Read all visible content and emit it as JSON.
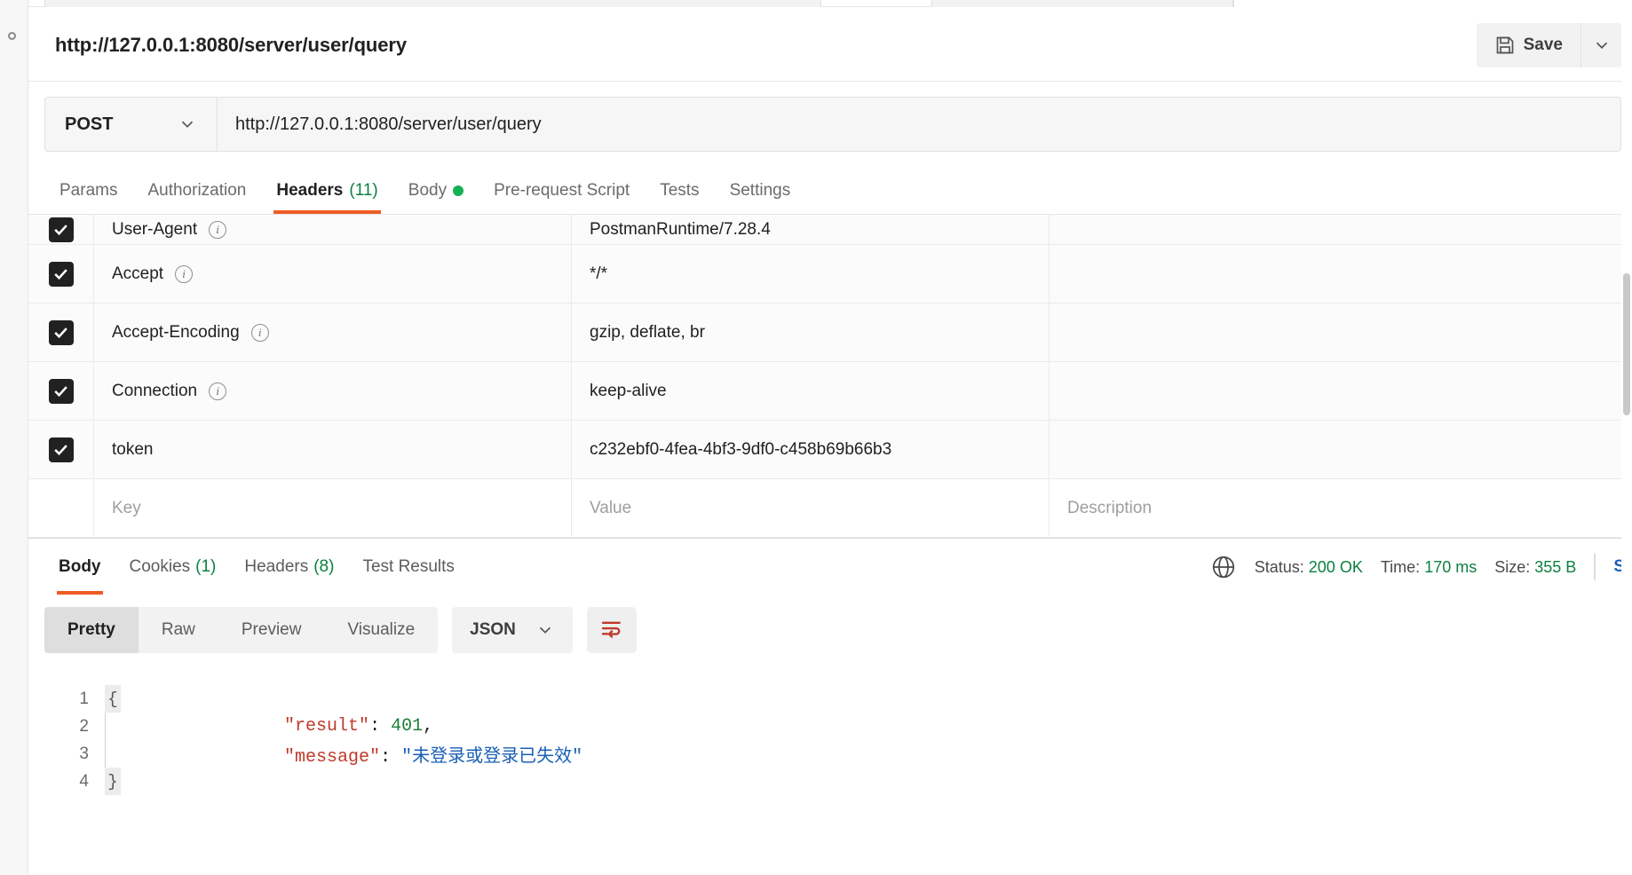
{
  "request": {
    "title": "http://127.0.0.1:8080/server/user/query",
    "method": "POST",
    "url": "http://127.0.0.1:8080/server/user/query",
    "save_label": "Save",
    "tabs": [
      {
        "label": "Params",
        "count": "",
        "active": false
      },
      {
        "label": "Authorization",
        "count": "",
        "active": false
      },
      {
        "label": "Headers",
        "count": "(11)",
        "active": true
      },
      {
        "label": "Body",
        "count": "",
        "active": false,
        "dot": true
      },
      {
        "label": "Pre-request Script",
        "count": "",
        "active": false
      },
      {
        "label": "Tests",
        "count": "",
        "active": false
      },
      {
        "label": "Settings",
        "count": "",
        "active": false
      }
    ]
  },
  "headers_table": {
    "columns": [
      "Key",
      "Value",
      "Description"
    ],
    "placeholders": {
      "key": "Key",
      "value": "Value",
      "description": "Description"
    },
    "rows": [
      {
        "checked": true,
        "key": "User-Agent",
        "info": true,
        "value": "PostmanRuntime/7.28.4",
        "description": ""
      },
      {
        "checked": true,
        "key": "Accept",
        "info": true,
        "value": "*/*",
        "description": ""
      },
      {
        "checked": true,
        "key": "Accept-Encoding",
        "info": true,
        "value": "gzip, deflate, br",
        "description": ""
      },
      {
        "checked": true,
        "key": "Connection",
        "info": true,
        "value": "keep-alive",
        "description": ""
      },
      {
        "checked": true,
        "key": "token",
        "info": false,
        "value": "c232ebf0-4fea-4bf3-9df0-c458b69b66b3",
        "description": ""
      }
    ]
  },
  "response": {
    "tabs": [
      {
        "label": "Body",
        "count": "",
        "active": true
      },
      {
        "label": "Cookies",
        "count": "(1)",
        "active": false
      },
      {
        "label": "Headers",
        "count": "(8)",
        "active": false
      },
      {
        "label": "Test Results",
        "count": "",
        "active": false
      }
    ],
    "status_label": "Status:",
    "status_value": "200 OK",
    "time_label": "Time:",
    "time_value": "170 ms",
    "size_label": "Size:",
    "size_value": "355 B",
    "save_response_label": "S",
    "format_buttons": [
      "Pretty",
      "Raw",
      "Preview",
      "Visualize"
    ],
    "active_format": "Pretty",
    "language": "JSON",
    "body_lines": [
      {
        "n": "1",
        "fold": "{",
        "text": ""
      },
      {
        "n": "2",
        "fold": "",
        "key": "\"result\"",
        "sep": ": ",
        "num": "401",
        "tail": ","
      },
      {
        "n": "3",
        "fold": "",
        "key": "\"message\"",
        "sep": ": ",
        "str": "\"未登录或登录已失效\"",
        "tail": ""
      },
      {
        "n": "4",
        "fold": "}",
        "text": ""
      }
    ]
  },
  "colors": {
    "accent_orange": "#ef5b25",
    "green": "#0b8040",
    "blue": "#1a5fb4",
    "red": "#c0392b"
  }
}
